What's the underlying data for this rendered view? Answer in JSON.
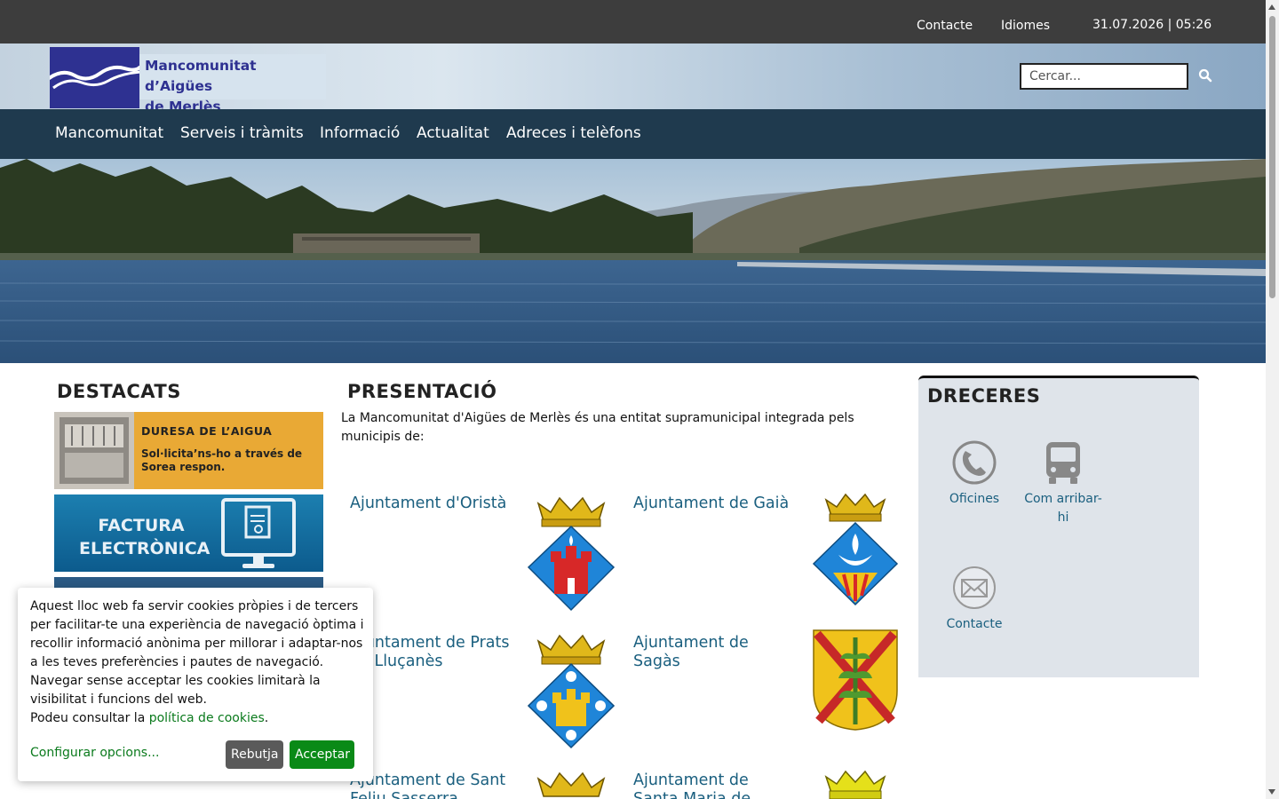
{
  "topbar": {
    "contact_label": "Contacte",
    "languages_label": "Idiomes",
    "datetime": "31.07.2026 | 05:26"
  },
  "header": {
    "logo_line1": "Mancomunitat d’Aigües",
    "logo_line2": "de Merlès",
    "search_placeholder": "Cercar..."
  },
  "nav": {
    "items": [
      {
        "label": "Mancomunitat"
      },
      {
        "label": "Serveis i tràmits"
      },
      {
        "label": "Informació"
      },
      {
        "label": "Actualitat"
      },
      {
        "label": "Adreces i telèfons"
      }
    ]
  },
  "destacats": {
    "title": "DESTACATS",
    "banner1": {
      "title": "DURESA DE L’AIGUA",
      "line1": "Sol·licita’ns-ho a través de",
      "line2": "Sorea respon."
    },
    "banner2": {
      "line1": "FACTURA",
      "line2": "ELECTRÒNICA"
    }
  },
  "presentacio": {
    "title": "PRESENTACIÓ",
    "intro": "La Mancomunitat d'Aigües de Merlès és una entitat supramunicipal integrada pels municipis de:",
    "municipalities": [
      {
        "line1": "Ajuntament d'Oristà",
        "line2": ""
      },
      {
        "line1": "Ajuntament de Gaià",
        "line2": ""
      },
      {
        "line1": "Ajuntament de Prats",
        "line2": "de Lluçanès"
      },
      {
        "line1": "Ajuntament de",
        "line2": "Sagàs"
      },
      {
        "line1": "Ajuntament de Sant",
        "line2": "Feliu Sasserra"
      },
      {
        "line1": "Ajuntament de",
        "line2": "Santa Maria de"
      }
    ]
  },
  "dreceres": {
    "title": "DRECERES",
    "shortcuts": [
      {
        "label": "Oficines"
      },
      {
        "line1": "Com arribar-",
        "line2": "hi"
      },
      {
        "label": "Contacte"
      }
    ]
  },
  "cookie": {
    "text": "Aquest lloc web fa servir cookies pròpies i de tercers per facilitar-te una experiència de navegació òptima i recollir informació anònima per millorar i adaptar-nos a les teves preferències i pautes de navegació. Navegar sense acceptar les cookies limitarà la visibilitat i funcions del web.",
    "policy_prefix": "Podeu consultar la ",
    "policy_link": "política de cookies",
    "policy_suffix": ".",
    "configure_label": "Configurar opcions...",
    "reject_label": "Rebutja",
    "accept_label": "Acceptar"
  },
  "colors": {
    "topbar": "#3d3d3d",
    "nav": "#1f3a4e",
    "link": "#1a5f7f",
    "accept": "#0a8a17",
    "reject": "#5a5a5a",
    "logo": "#2e3191"
  }
}
